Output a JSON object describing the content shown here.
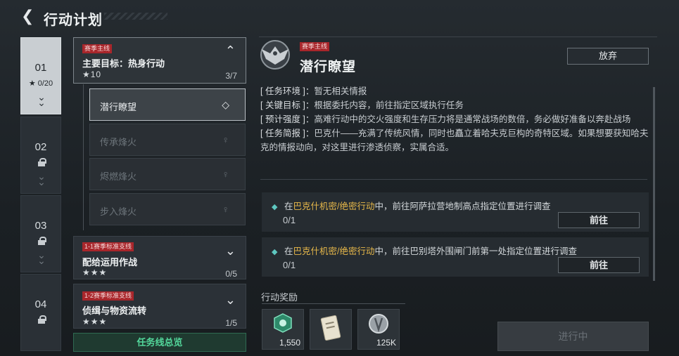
{
  "header": {
    "title": "行动计划"
  },
  "tabs": [
    {
      "num": "01",
      "sub": "★ 0/20",
      "locked": false,
      "active": true
    },
    {
      "num": "02",
      "locked": true
    },
    {
      "num": "03",
      "locked": true
    },
    {
      "num": "04",
      "locked": true
    }
  ],
  "missions": [
    {
      "tag": "赛季主线",
      "name": "主要目标：热身行动",
      "stars": "★10",
      "progress": "3/7"
    },
    {
      "tag": "1-1赛季标准支线",
      "name": "配给运用作战",
      "stars": "★★★",
      "progress": "0/5"
    },
    {
      "tag": "1-2赛季标准支线",
      "name": "侦缉与物资流转",
      "stars": "★★★",
      "progress": "1/5"
    }
  ],
  "submissions": [
    {
      "label": "潜行瞭望",
      "active": true
    },
    {
      "label": "传承烽火",
      "active": false
    },
    {
      "label": "烬燃烽火",
      "active": false
    },
    {
      "label": "步入烽火",
      "active": false
    }
  ],
  "overview_label": "任务线总览",
  "detail": {
    "tag": "赛季主线",
    "title": "潜行瞭望",
    "abandon_label": "放弃",
    "info": [
      {
        "key": "[ 任务环境 ]",
        "value": "暂无相关情报"
      },
      {
        "key": "[ 关键目标 ]",
        "value": "根据委托内容，前往指定区域执行任务"
      },
      {
        "key": "[ 预计强度 ]",
        "value": "高难行动中的交火强度和生存压力将是通常战场的数倍，务必做好准备以奔赴战场"
      },
      {
        "key": "[ 任务简报 ]",
        "value": "巴克什——充满了传统风情，同时也矗立着哈夫克巨构的奇特区域。如果想要获知哈夫克的情报动向，对这里进行渗透侦察，实属合适。"
      }
    ],
    "tasks": [
      {
        "pre": "在",
        "highlight": "巴克什机密/绝密行动",
        "post": "中，前往阿萨拉营地制高点指定位置进行调查",
        "count": "0/1",
        "go_label": "前往"
      },
      {
        "pre": "在",
        "highlight": "巴克什机密/绝密行动",
        "post": "中，前往巴别塔外围闸门前第一处指定位置进行调查",
        "count": "0/1",
        "go_label": "前往"
      }
    ],
    "rewards_label": "行动奖励",
    "rewards": [
      {
        "icon": "green-token-icon",
        "amount": "1,550"
      },
      {
        "icon": "document-card-icon",
        "amount": ""
      },
      {
        "icon": "silver-coin-icon",
        "amount": "125K"
      }
    ],
    "status_label": "进行中"
  },
  "colors": {
    "accent_red": "#a8262b",
    "highlight": "#e8b94a",
    "green": "#53d79b"
  }
}
